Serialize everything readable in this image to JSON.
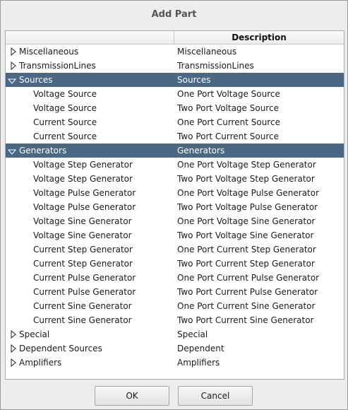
{
  "window": {
    "title": "Add Part"
  },
  "table": {
    "columns": [
      "",
      "Description"
    ]
  },
  "rows": [
    {
      "name": "Miscellaneous",
      "desc": "Miscellaneous",
      "level": 0,
      "expanded": false,
      "selected": false
    },
    {
      "name": "TransmissionLines",
      "desc": "TransmissionLines",
      "level": 0,
      "expanded": false,
      "selected": false
    },
    {
      "name": "Sources",
      "desc": "Sources",
      "level": 0,
      "expanded": true,
      "selected": true
    },
    {
      "name": "Voltage Source",
      "desc": "One Port Voltage Source",
      "level": 1
    },
    {
      "name": "Voltage Source",
      "desc": "Two Port Voltage Source",
      "level": 1
    },
    {
      "name": "Current Source",
      "desc": "One Port Current Source",
      "level": 1
    },
    {
      "name": "Current Source",
      "desc": "Two Port Current Source",
      "level": 1
    },
    {
      "name": "Generators",
      "desc": "Generators",
      "level": 0,
      "expanded": true,
      "selected": true
    },
    {
      "name": "Voltage Step Generator",
      "desc": "One Port Voltage Step Generator",
      "level": 1
    },
    {
      "name": "Voltage Step Generator",
      "desc": "Two Port Voltage Step Generator",
      "level": 1
    },
    {
      "name": "Voltage Pulse Generator",
      "desc": "One Port Voltage Pulse Generator",
      "level": 1
    },
    {
      "name": "Voltage Pulse Generator",
      "desc": "Two Port Voltage Pulse Generator",
      "level": 1
    },
    {
      "name": "Voltage Sine Generator",
      "desc": "One Port Voltage Sine Generator",
      "level": 1
    },
    {
      "name": "Voltage Sine Generator",
      "desc": "Two Port Voltage Sine Generator",
      "level": 1
    },
    {
      "name": "Current Step Generator",
      "desc": "One Port Current Step Generator",
      "level": 1
    },
    {
      "name": "Current Step Generator",
      "desc": "Two Port Current Step Generator",
      "level": 1
    },
    {
      "name": "Current Pulse Generator",
      "desc": "One Port Current Pulse Generator",
      "level": 1
    },
    {
      "name": "Current Pulse Generator",
      "desc": "Two Port Current Pulse Generator",
      "level": 1
    },
    {
      "name": "Current Sine Generator",
      "desc": "One Port Current Sine Generator",
      "level": 1
    },
    {
      "name": "Current Sine Generator",
      "desc": "Two Port Current Sine Generator",
      "level": 1
    },
    {
      "name": "Special",
      "desc": "Special",
      "level": 0,
      "expanded": false,
      "selected": false
    },
    {
      "name": "Dependent Sources",
      "desc": "Dependent",
      "level": 0,
      "expanded": false,
      "selected": false
    },
    {
      "name": "Amplifiers",
      "desc": "Amplifiers",
      "level": 0,
      "expanded": false,
      "selected": false
    }
  ],
  "buttons": {
    "ok": "OK",
    "cancel": "Cancel"
  },
  "colors": {
    "selection": "#4a6784",
    "selection_text": "#ffffff",
    "text": "#1a1a1a"
  },
  "icons": {
    "collapsed": "triangle-right-icon",
    "expanded": "triangle-down-icon"
  }
}
